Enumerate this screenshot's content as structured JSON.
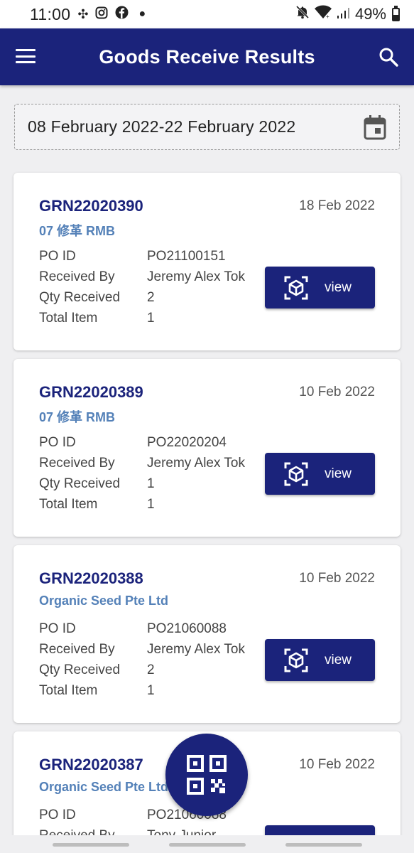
{
  "status_bar": {
    "time": "11:00",
    "battery": "49%"
  },
  "app_bar": {
    "title": "Goods Receive Results"
  },
  "date_range": {
    "text": "08 February 2022-22 February 2022"
  },
  "labels": {
    "po_id": "PO ID",
    "received_by": "Received By",
    "qty_received": "Qty Received",
    "total_item": "Total Item",
    "view": "view"
  },
  "cards": [
    {
      "grn": "GRN22020390",
      "date": "18 Feb 2022",
      "supplier": "07 修革 RMB",
      "po_id": "PO21100151",
      "received_by": "Jeremy Alex Tok",
      "qty_received": "2",
      "total_item": "1"
    },
    {
      "grn": "GRN22020389",
      "date": "10 Feb 2022",
      "supplier": "07 修革 RMB",
      "po_id": "PO22020204",
      "received_by": "Jeremy Alex Tok",
      "qty_received": "1",
      "total_item": "1"
    },
    {
      "grn": "GRN22020388",
      "date": "10 Feb 2022",
      "supplier": "Organic Seed Pte Ltd",
      "po_id": "PO21060088",
      "received_by": "Jeremy Alex Tok",
      "qty_received": "2",
      "total_item": "1"
    },
    {
      "grn": "GRN22020387",
      "date": "10 Feb 2022",
      "supplier": "Organic Seed Pte Ltd",
      "po_id": "PO21060088",
      "received_by": "Tony Junior",
      "qty_received": "",
      "total_item": ""
    }
  ],
  "colors": {
    "primary": "#1b237b",
    "supplier": "#5481b8",
    "background": "#efeff1"
  },
  "icons": {
    "menu": "menu-icon",
    "search": "search-icon",
    "calendar": "calendar-icon",
    "view": "ar-cube-icon",
    "fab": "qr-code-icon"
  }
}
